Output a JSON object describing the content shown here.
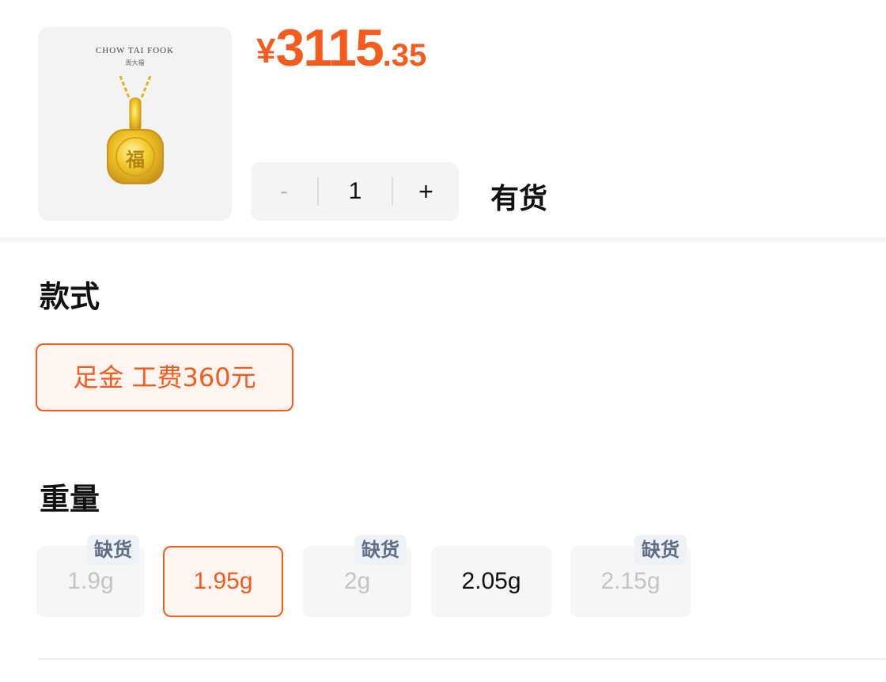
{
  "product": {
    "brand_en": "CHOW TAI FOOK",
    "brand_cn": "周大福",
    "pendant_char": "福",
    "image_icon": "gold-pendant-icon"
  },
  "price": {
    "currency": "¥",
    "integer": "3115",
    "decimal": ".35",
    "color": "#f25c1f"
  },
  "quantity": {
    "minus": "-",
    "value": "1",
    "plus": "+"
  },
  "stock_status": "有货",
  "style_section": {
    "title": "款式",
    "options": [
      {
        "label": "足金 工费360元",
        "selected": true
      }
    ]
  },
  "weight_section": {
    "title": "重量",
    "out_of_stock_label": "缺货",
    "options": [
      {
        "label": "1.9g",
        "available": false,
        "selected": false
      },
      {
        "label": "1.95g",
        "available": true,
        "selected": true
      },
      {
        "label": "2g",
        "available": false,
        "selected": false
      },
      {
        "label": "2.05g",
        "available": true,
        "selected": false
      },
      {
        "label": "2.15g",
        "available": false,
        "selected": false
      }
    ]
  },
  "colors": {
    "accent": "#f25c1f",
    "oos_badge_bg": "#eef1f6",
    "oos_badge_text": "#5d6d85"
  }
}
